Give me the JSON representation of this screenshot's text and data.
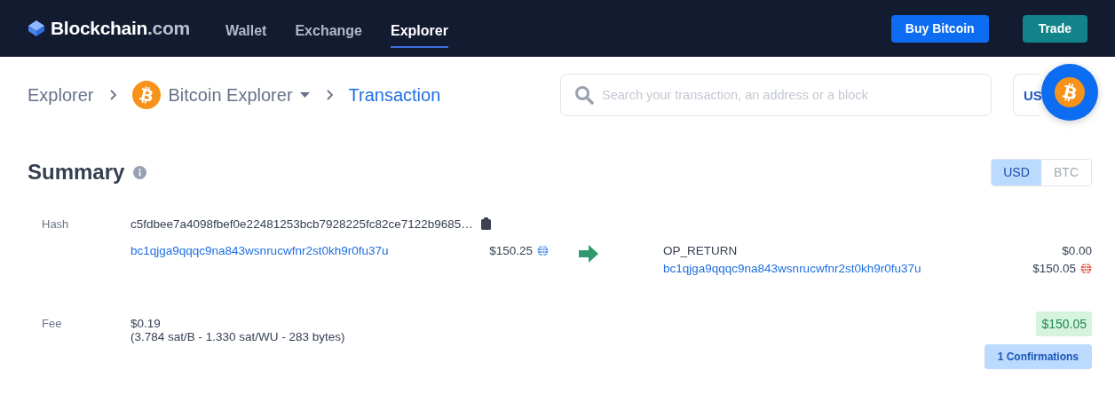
{
  "nav": {
    "logo": {
      "name": "Blockchain",
      "suffix": ".com"
    },
    "tabs": [
      {
        "label": "Wallet",
        "selected": false
      },
      {
        "label": "Exchange",
        "selected": false
      },
      {
        "label": "Explorer",
        "selected": true
      }
    ],
    "buttons": [
      {
        "label": "Buy Bitcoin",
        "kind": "primary"
      },
      {
        "label": "Trade",
        "kind": "secondary"
      }
    ]
  },
  "breadcrumb": [
    {
      "label": "Explorer",
      "kind": "link"
    },
    {
      "label": "Bitcoin Explorer",
      "kind": "dropdown"
    },
    {
      "label": "Transaction",
      "kind": "current"
    }
  ],
  "search": {
    "placeholder": "Search your transaction, an address or a block"
  },
  "currency_button": {
    "label": "US"
  },
  "summary": {
    "title": "Summary",
    "units": [
      {
        "label": "USD",
        "selected": true
      },
      {
        "label": "BTC",
        "selected": false
      }
    ],
    "hash_label": "Hash",
    "hash": "c5fdbee7a4098fbef0e22481253bcb7928225fc82ce7122b9685…",
    "inputs": [
      {
        "address": "bc1qjga9qqqc9na843wsnrucwfnr2st0kh9r0fu37u",
        "kind": "link",
        "amount": "$150.25",
        "color": "#4a8df0"
      }
    ],
    "outputs": [
      {
        "address": "OP_RETURN",
        "kind": "text",
        "amount": "$0.00"
      },
      {
        "address": "bc1qjga9qqqc9na843wsnrucwfnr2st0kh9r0fu37u",
        "kind": "link",
        "amount": "$150.05",
        "color": "#e8503c"
      }
    ],
    "fee_label": "Fee",
    "fee": "$0.19",
    "fee_detail": "(3.784 sat/B - 1.330 sat/WU - 283 bytes)",
    "total": "$150.05",
    "confirmations": "1 Confirmations"
  }
}
